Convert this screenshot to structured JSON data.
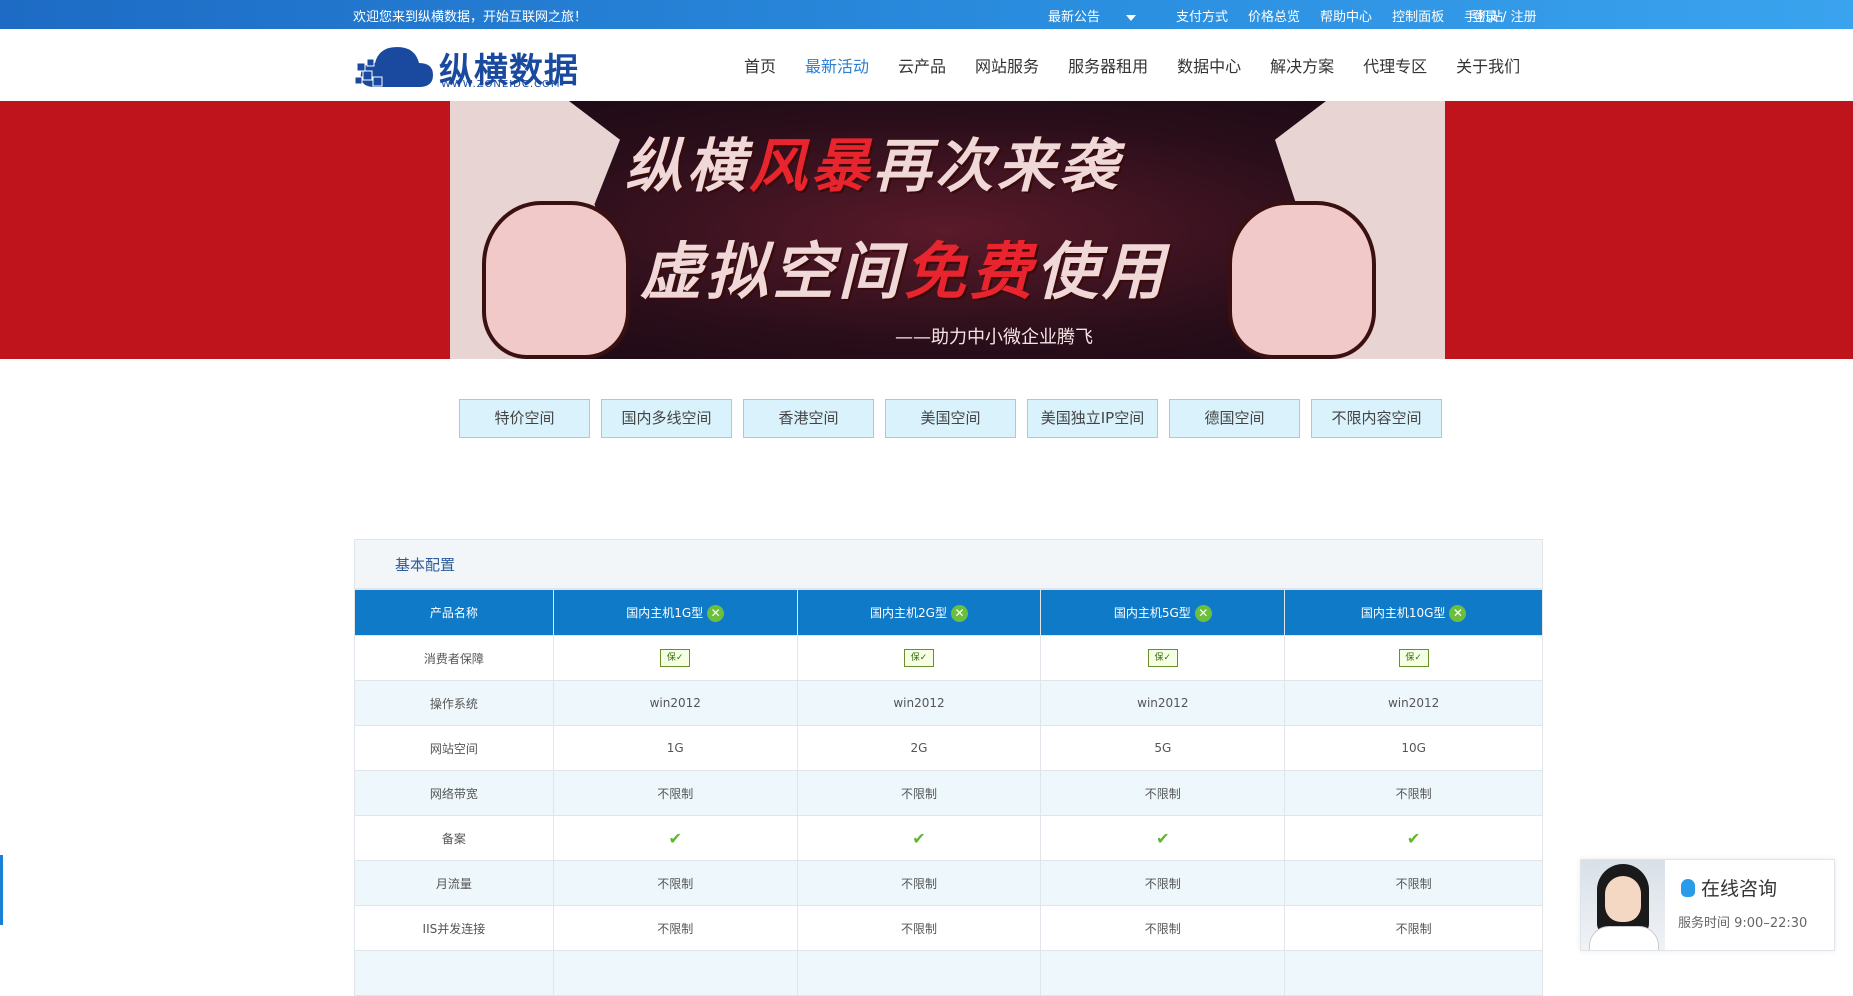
{
  "topbar": {
    "welcome": "欢迎您来到纵横数据，开始互联网之旅！",
    "links": [
      "最新公告",
      "支付方式",
      "价格总览",
      "帮助中心",
      "控制面板",
      "手机站"
    ],
    "login": "登录 / 注册"
  },
  "logo": {
    "brand": "纵横数据",
    "url": "WWW.ZONEIDC.COM"
  },
  "nav": {
    "items": [
      "首页",
      "最新活动",
      "云产品",
      "网站服务",
      "服务器租用",
      "数据中心",
      "解决方案",
      "代理专区",
      "关于我们"
    ],
    "active": "最新活动"
  },
  "banner": {
    "line1_a": "纵横",
    "line1_b": "风暴",
    "line1_c": "再次来袭",
    "line2_a": "虚拟空间",
    "line2_b": "免费",
    "line2_c": "使用",
    "sub": "——助力中小微企业腾飞"
  },
  "tabs": [
    "特价空间",
    "国内多线空间",
    "香港空间",
    "美国空间",
    "美国独立IP空间",
    "德国空间",
    "不限内容空间"
  ],
  "spec": {
    "title": "基本配置",
    "header": [
      "产品名称",
      "国内主机1G型",
      "国内主机2G型",
      "国内主机5G型",
      "国内主机10G型"
    ],
    "rows": [
      {
        "label": "消费者保障",
        "values": [
          "guarantee",
          "guarantee",
          "guarantee",
          "guarantee"
        ]
      },
      {
        "label": "操作系统",
        "values": [
          "win2012",
          "win2012",
          "win2012",
          "win2012"
        ]
      },
      {
        "label": "网站空间",
        "values": [
          "1G",
          "2G",
          "5G",
          "10G"
        ]
      },
      {
        "label": "网络带宽",
        "values": [
          "不限制",
          "不限制",
          "不限制",
          "不限制"
        ]
      },
      {
        "label": "备案",
        "values": [
          "check",
          "check",
          "check",
          "check"
        ]
      },
      {
        "label": "月流量",
        "values": [
          "不限制",
          "不限制",
          "不限制",
          "不限制"
        ]
      },
      {
        "label": "IIS并发连接",
        "values": [
          "不限制",
          "不限制",
          "不限制",
          "不限制"
        ]
      }
    ]
  },
  "consult": {
    "title": "在线咨询",
    "hours": "服务时间 9:00–22:30"
  },
  "colors": {
    "primary": "#0f7ac8",
    "accent": "#2b7fd4",
    "banner": "#c0141d",
    "tab_bg": "#d9f2fb"
  }
}
